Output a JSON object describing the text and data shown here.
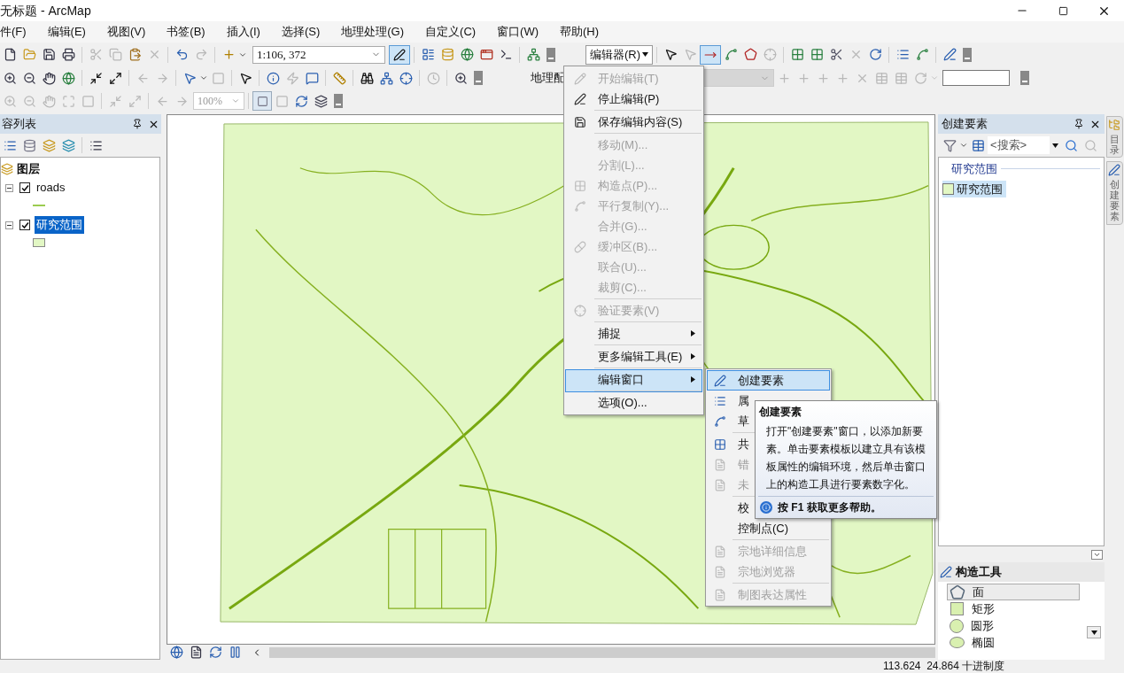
{
  "window": {
    "title": "无标题 - ArcMap"
  },
  "menu_bar": [
    {
      "label": "件(F)"
    },
    {
      "label": "编辑(E)"
    },
    {
      "label": "视图(V)"
    },
    {
      "label": "书签(B)"
    },
    {
      "label": "插入(I)"
    },
    {
      "label": "选择(S)"
    },
    {
      "label": "地理处理(G)"
    },
    {
      "label": "自定义(C)"
    },
    {
      "label": "窗口(W)"
    },
    {
      "label": "帮助(H)"
    }
  ],
  "standard_toolbar": {
    "scale": "1:106, 372"
  },
  "editor_toolbar": {
    "label": "编辑器(R)",
    "expanded": true
  },
  "georef_toolbar": {
    "label": "地理配"
  },
  "layout_toolbar": {
    "zoom": "100%"
  },
  "toc": {
    "title": "容列表",
    "root": "图层",
    "layers": [
      {
        "name": "roads",
        "checked": true,
        "selected": false,
        "kind": "line"
      },
      {
        "name": "研究范围",
        "checked": true,
        "selected": true,
        "kind": "fill"
      }
    ]
  },
  "editor_menu": {
    "items": [
      {
        "label": "开始编辑(T)",
        "disabled": true,
        "selected": false,
        "submenu": false,
        "separator_after": false
      },
      {
        "label": "停止编辑(P)",
        "disabled": false,
        "selected": false,
        "submenu": false,
        "separator_after": true
      },
      {
        "label": "保存编辑内容(S)",
        "disabled": false,
        "selected": false,
        "submenu": false,
        "separator_after": true
      },
      {
        "label": "移动(M)...",
        "disabled": true,
        "selected": false,
        "submenu": false,
        "separator_after": false
      },
      {
        "label": "分割(L)...",
        "disabled": true,
        "selected": false,
        "submenu": false,
        "separator_after": false
      },
      {
        "label": "构造点(P)...",
        "disabled": true,
        "selected": false,
        "submenu": false,
        "separator_after": false
      },
      {
        "label": "平行复制(Y)...",
        "disabled": true,
        "selected": false,
        "submenu": false,
        "separator_after": false
      },
      {
        "label": "合并(G)...",
        "disabled": true,
        "selected": false,
        "submenu": false,
        "separator_after": false
      },
      {
        "label": "缓冲区(B)...",
        "disabled": true,
        "selected": false,
        "submenu": false,
        "separator_after": false
      },
      {
        "label": "联合(U)...",
        "disabled": true,
        "selected": false,
        "submenu": false,
        "separator_after": false
      },
      {
        "label": "裁剪(C)...",
        "disabled": true,
        "selected": false,
        "submenu": false,
        "separator_after": true
      },
      {
        "label": "验证要素(V)",
        "disabled": true,
        "selected": false,
        "submenu": false,
        "separator_after": true
      },
      {
        "label": "捕捉",
        "disabled": false,
        "selected": false,
        "submenu": true,
        "separator_after": true
      },
      {
        "label": "更多编辑工具(E)",
        "disabled": false,
        "selected": false,
        "submenu": true,
        "separator_after": true
      },
      {
        "label": "编辑窗口",
        "disabled": false,
        "selected": true,
        "submenu": true,
        "separator_after": true
      },
      {
        "label": "选项(O)...",
        "disabled": false,
        "selected": false,
        "submenu": false,
        "separator_after": false
      }
    ]
  },
  "edit_windows_submenu": {
    "items": [
      {
        "label": "创建要素",
        "disabled": false,
        "selected": true,
        "separator_after": false
      },
      {
        "label": "属",
        "disabled": false,
        "selected": false,
        "separator_after": false
      },
      {
        "label": "草",
        "disabled": false,
        "selected": false,
        "separator_after": true
      },
      {
        "label": "共",
        "disabled": false,
        "selected": false,
        "separator_after": false
      },
      {
        "label": "错",
        "disabled": true,
        "selected": false,
        "separator_after": false
      },
      {
        "label": "未",
        "disabled": true,
        "selected": false,
        "separator_after": true
      },
      {
        "label": "校",
        "disabled": false,
        "selected": false,
        "separator_after": false
      },
      {
        "label": "控制点(C)",
        "disabled": false,
        "selected": false,
        "separator_after": true
      },
      {
        "label": "宗地详细信息",
        "disabled": true,
        "selected": false,
        "separator_after": false
      },
      {
        "label": "宗地浏览器",
        "disabled": true,
        "selected": false,
        "separator_after": true
      },
      {
        "label": "制图表达属性",
        "disabled": true,
        "selected": false,
        "separator_after": false
      }
    ]
  },
  "tooltip": {
    "title": "创建要素",
    "body": "打开\"创建要素\"窗口，以添加新要素。单击要素模板以建立具有该模板属性的编辑环境，然后单击窗口上的构造工具进行要素数字化。",
    "help": "按 F1 获取更多帮助。"
  },
  "create_features": {
    "title": "创建要素",
    "search_placeholder": "<搜索>",
    "group": "研究范围",
    "templates": [
      {
        "name": "研究范围",
        "selected": true
      }
    ]
  },
  "construction_tools": {
    "title": "构造工具",
    "tools": [
      {
        "name": "面",
        "selected": true,
        "kind": "polygon"
      },
      {
        "name": "矩形",
        "selected": false,
        "kind": "rectangle"
      },
      {
        "name": "圆形",
        "selected": false,
        "kind": "circle"
      },
      {
        "name": "椭圆",
        "selected": false,
        "kind": "ellipse"
      }
    ]
  },
  "side_tabs": [
    {
      "label": "目录"
    },
    {
      "label": "创建要素"
    }
  ],
  "status_bar": {
    "coordinates": "113.624  24.864 十进制度"
  }
}
